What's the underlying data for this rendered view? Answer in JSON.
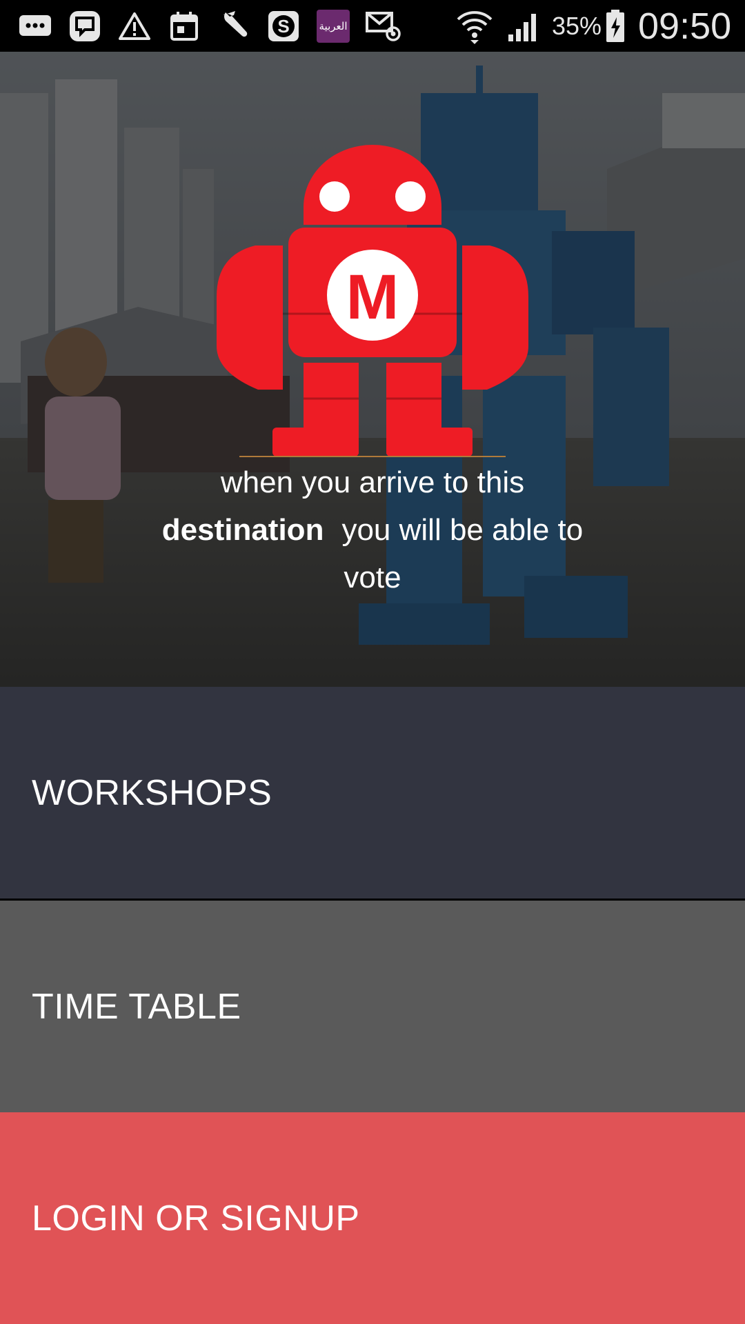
{
  "status_bar": {
    "icons": [
      "chat-bubble-icon",
      "messenger-icon",
      "warning-icon",
      "calendar-icon",
      "wrench-icon",
      "dollar-app-icon",
      "news-app-icon",
      "email-at-icon",
      "wifi-icon",
      "signal-icon",
      "battery-charging-icon"
    ],
    "news_app_text": "العربية",
    "battery_percent": "35%",
    "time": "09:50"
  },
  "hero": {
    "logo_letter": "M",
    "tagline": {
      "line1": "when you arrive to this",
      "bold_word": "destination",
      "line2_rest": "you will be able to",
      "line3": "vote"
    }
  },
  "menu": {
    "workshops": "WORKSHOPS",
    "timetable": "TIME TABLE",
    "login": "LOGIN OR SIGNUP"
  },
  "colors": {
    "status_bar_bg": "#000000",
    "logo_red": "#ee1c25",
    "workshops_bg": "#323440",
    "timetable_bg": "#5a5a5a",
    "login_bg": "#e05356",
    "text": "#ffffff"
  }
}
